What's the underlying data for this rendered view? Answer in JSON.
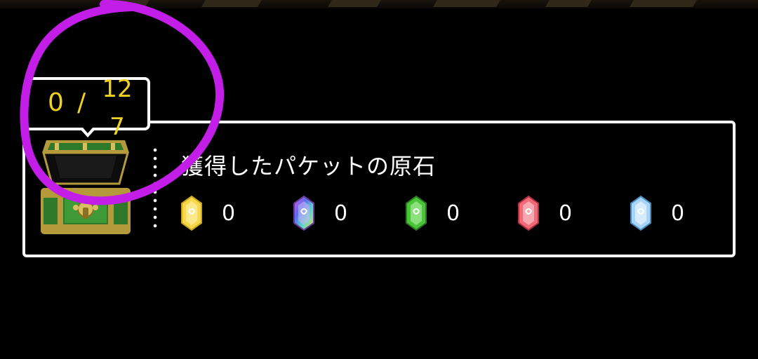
{
  "panel": {
    "title": "獲得したパケットの原石"
  },
  "counter": {
    "current": "0",
    "separator": "/",
    "total": "127"
  },
  "gems": [
    {
      "name": "yellow-gem-icon",
      "color": "#f6d84a",
      "count": "0"
    },
    {
      "name": "rainbow-gem-icon",
      "color": "#9b6be0",
      "count": "0"
    },
    {
      "name": "green-gem-icon",
      "color": "#4cc43a",
      "count": "0"
    },
    {
      "name": "red-gem-icon",
      "color": "#f06a78",
      "count": "0"
    },
    {
      "name": "blue-gem-icon",
      "color": "#a8d4f8",
      "count": "0"
    }
  ],
  "colors": {
    "counter_text": "#f0d020",
    "annotation": "#c21ee8",
    "frame": "#ffffff",
    "chest_green": "#2e7a2a",
    "chest_gold": "#b49a3a"
  }
}
